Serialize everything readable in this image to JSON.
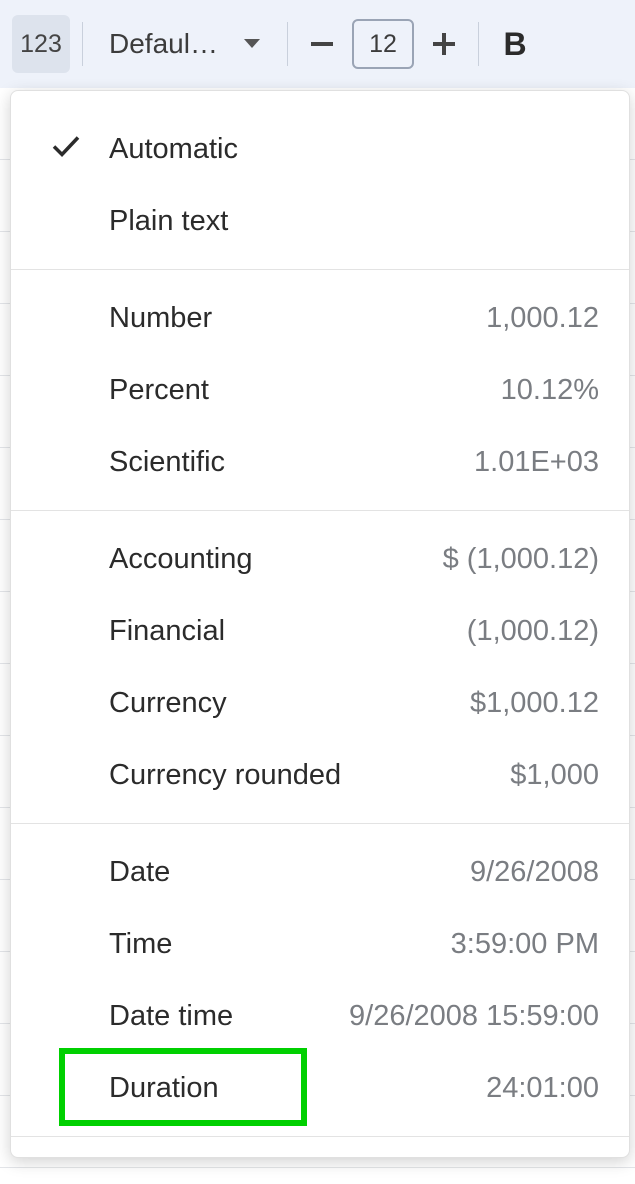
{
  "toolbar": {
    "format_button": "123",
    "font_label": "Defaul…",
    "font_size": "12",
    "bold_label": "B"
  },
  "menu": {
    "groups": [
      {
        "items": [
          {
            "label": "Automatic",
            "example": "",
            "checked": true
          },
          {
            "label": "Plain text",
            "example": "",
            "checked": false
          }
        ]
      },
      {
        "items": [
          {
            "label": "Number",
            "example": "1,000.12",
            "checked": false
          },
          {
            "label": "Percent",
            "example": "10.12%",
            "checked": false
          },
          {
            "label": "Scientific",
            "example": "1.01E+03",
            "checked": false
          }
        ]
      },
      {
        "items": [
          {
            "label": "Accounting",
            "example": "$ (1,000.12)",
            "checked": false
          },
          {
            "label": "Financial",
            "example": "(1,000.12)",
            "checked": false
          },
          {
            "label": "Currency",
            "example": "$1,000.12",
            "checked": false
          },
          {
            "label": "Currency rounded",
            "example": "$1,000",
            "checked": false
          }
        ]
      },
      {
        "items": [
          {
            "label": "Date",
            "example": "9/26/2008",
            "checked": false
          },
          {
            "label": "Time",
            "example": "3:59:00 PM",
            "checked": false
          },
          {
            "label": "Date time",
            "example": "9/26/2008 15:59:00",
            "checked": false
          },
          {
            "label": "Duration",
            "example": "24:01:00",
            "checked": false
          }
        ]
      }
    ]
  }
}
